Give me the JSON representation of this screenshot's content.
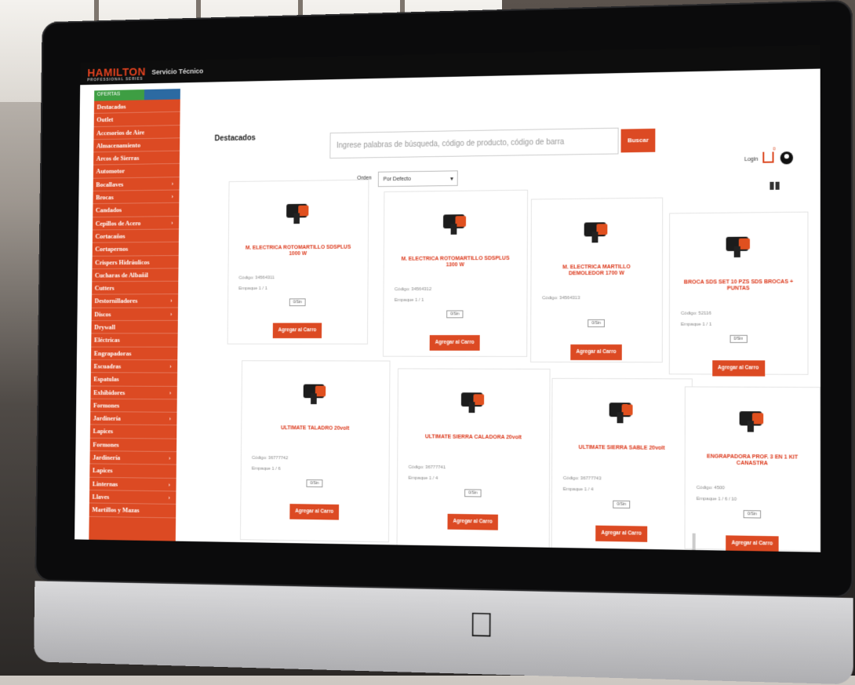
{
  "header": {
    "logo_text": "HAMILTON",
    "logo_subtext": "PROFESSIONAL SERIES",
    "nav_link": "Servicio Técnico"
  },
  "sidebar": {
    "header_label": "OFERTAS",
    "items": [
      {
        "label": "Destacados",
        "has_submenu": false
      },
      {
        "label": "Outlet",
        "has_submenu": false
      },
      {
        "label": "Accesorios de Aire",
        "has_submenu": false
      },
      {
        "label": "Almacenamiento",
        "has_submenu": false
      },
      {
        "label": "Arcos de Sierras",
        "has_submenu": false
      },
      {
        "label": "Automotor",
        "has_submenu": false
      },
      {
        "label": "Bocallaves",
        "has_submenu": true
      },
      {
        "label": "Brocas",
        "has_submenu": true
      },
      {
        "label": "Candados",
        "has_submenu": false
      },
      {
        "label": "Cepillos de Acero",
        "has_submenu": true
      },
      {
        "label": "Cortacaños",
        "has_submenu": false
      },
      {
        "label": "Cortapernos",
        "has_submenu": false
      },
      {
        "label": "Crispers Hidráulicos",
        "has_submenu": false
      },
      {
        "label": "Cucharas de Albañil",
        "has_submenu": false
      },
      {
        "label": "Cutters",
        "has_submenu": false
      },
      {
        "label": "Destornilladores",
        "has_submenu": true
      },
      {
        "label": "Discos",
        "has_submenu": true
      },
      {
        "label": "Drywall",
        "has_submenu": false
      },
      {
        "label": "Eléctricas",
        "has_submenu": false
      },
      {
        "label": "Engrapadoras",
        "has_submenu": false
      },
      {
        "label": "Escuadras",
        "has_submenu": true
      },
      {
        "label": "Espatulas",
        "has_submenu": false
      },
      {
        "label": "Exhibidores",
        "has_submenu": true
      },
      {
        "label": "Formones",
        "has_submenu": false
      },
      {
        "label": "Jardinería",
        "has_submenu": true
      },
      {
        "label": "Lapices",
        "has_submenu": false
      },
      {
        "label": "Formones",
        "has_submenu": false
      },
      {
        "label": "Jardinería",
        "has_submenu": true
      },
      {
        "label": "Lapices",
        "has_submenu": false
      },
      {
        "label": "Linternas",
        "has_submenu": true
      },
      {
        "label": "Llaves",
        "has_submenu": true
      },
      {
        "label": "Martillos y Mazas",
        "has_submenu": false
      }
    ]
  },
  "main": {
    "page_title": "Destacados",
    "search_placeholder": "Ingrese palabras de búsqueda, código de producto, código de barra",
    "search_button": "Buscar",
    "login_label": "Login",
    "order_label": "Orden",
    "order_selected": "Por Defecto",
    "products": [
      {
        "name": "M. ELECTRICA ROTOMARTILLO SDSPLUS 1000 W",
        "code": "Código: 34564311",
        "pack": "Empaque 1 / 1",
        "qty": "0/Sin",
        "add_label": "Agregar al Carro"
      },
      {
        "name": "M. ELECTRICA ROTOMARTILLO SDSPLUS 1300 W",
        "code": "Código: 34564312",
        "pack": "Empaque 1 / 1",
        "qty": "0/Sin",
        "add_label": "Agregar al Carro"
      },
      {
        "name": "M. ELECTRICA MARTILLO DEMOLEDOR 1700 W",
        "code": "Código: 34564313",
        "pack": "",
        "qty": "0/Sin",
        "add_label": "Agregar al Carro"
      },
      {
        "name": "BROCA SDS SET 10 PZS SDS BROCAS + PUNTAS",
        "code": "Código: 52116",
        "pack": "Empaque 1 / 1",
        "qty": "0/Sin",
        "add_label": "Agregar al Carro"
      },
      {
        "name": "ULTIMATE TALADRO 20volt",
        "code": "Código: 36777742",
        "pack": "Empaque 1 / 6",
        "qty": "0/Sin",
        "add_label": "Agregar al Carro"
      },
      {
        "name": "ULTIMATE SIERRA CALADORA 20volt",
        "code": "Código: 36777741",
        "pack": "Empaque 1 / 4",
        "qty": "0/Sin",
        "add_label": "Agregar al Carro"
      },
      {
        "name": "ULTIMATE SIERRA SABLE 20volt",
        "code": "Código: 36777743",
        "pack": "Empaque 1 / 4",
        "qty": "0/Sin",
        "add_label": "Agregar al Carro"
      },
      {
        "name": "ENGRAPADORA PROF. 3 EN 1 KIT CANASTRA",
        "code": "Código: 4500",
        "pack": "Empaque 1 / 6 / 10",
        "qty": "0/Sin",
        "add_label": "Agregar al Carro"
      }
    ]
  },
  "colors": {
    "accent": "#dc4a23",
    "sidebar_green": "#3e9e43",
    "sidebar_blue": "#2c6aa2",
    "topbar": "#0d0d0d"
  },
  "icons": [
    "cart-icon",
    "user-icon",
    "grid-view-icon",
    "chevron-right-icon",
    "apple-logo-icon"
  ]
}
